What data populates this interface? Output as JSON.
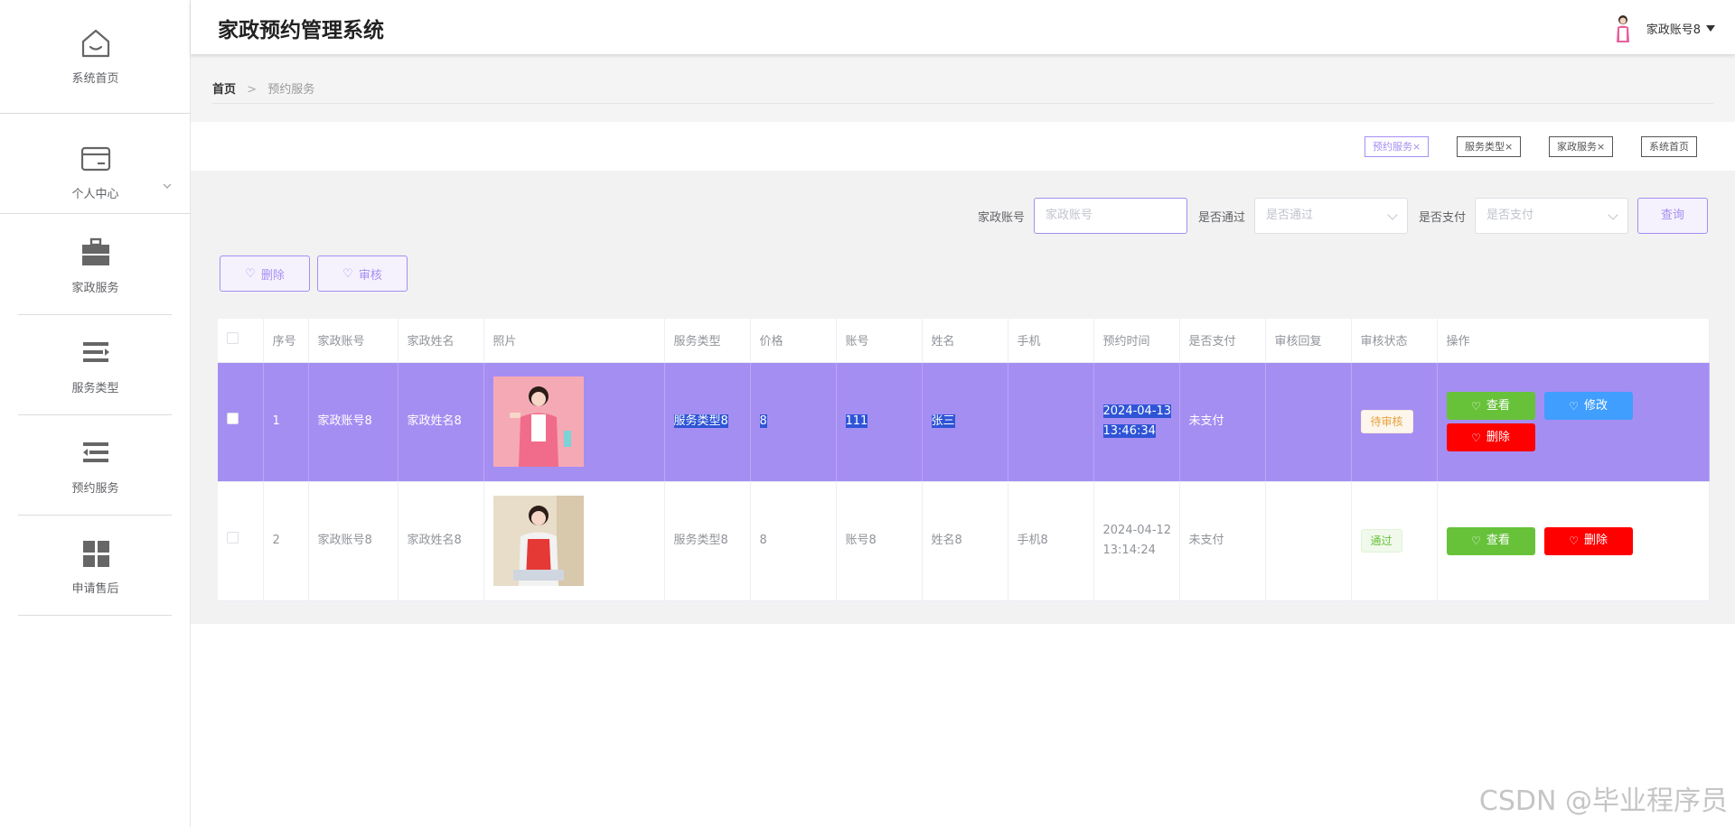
{
  "app": {
    "title": "家政预约管理系统"
  },
  "user": {
    "name": "家政账号8"
  },
  "sidebar": {
    "items": [
      {
        "label": "系统首页",
        "icon": "home-icon"
      },
      {
        "label": "个人中心",
        "icon": "card-icon"
      },
      {
        "label": "家政服务",
        "icon": "briefcase-icon"
      },
      {
        "label": "服务类型",
        "icon": "list-arrow-icon"
      },
      {
        "label": "预约服务",
        "icon": "list-left-icon"
      },
      {
        "label": "申请售后",
        "icon": "grid-icon"
      }
    ]
  },
  "breadcrumb": {
    "home": "首页",
    "separator": ">",
    "current": "预约服务"
  },
  "tabs": [
    {
      "label": "预约服务",
      "active": true
    },
    {
      "label": "服务类型"
    },
    {
      "label": "家政服务"
    },
    {
      "label": "系统首页"
    }
  ],
  "search": {
    "account_label": "家政账号",
    "account_placeholder": "家政账号",
    "approved_label": "是否通过",
    "approved_placeholder": "是否通过",
    "paid_label": "是否支付",
    "paid_placeholder": "是否支付",
    "query_label": "查询"
  },
  "actions": {
    "delete_label": "删除",
    "review_label": "审核"
  },
  "table": {
    "columns": [
      "序号",
      "家政账号",
      "家政姓名",
      "照片",
      "服务类型",
      "价格",
      "账号",
      "姓名",
      "手机",
      "预约时间",
      "是否支付",
      "审核回复",
      "审核状态",
      "操作"
    ],
    "rows": [
      {
        "index": "1",
        "account": "家政账号8",
        "name": "家政姓名8",
        "photo": "photo",
        "service_type": "服务类型8",
        "price": "8",
        "user_account": "111",
        "user_name": "张三",
        "phone": "",
        "time": "2024-04-13 13:46:34",
        "paid": "未支付",
        "reply": "",
        "status": "待审核",
        "ops": [
          "查看",
          "修改",
          "删除"
        ]
      },
      {
        "index": "2",
        "account": "家政账号8",
        "name": "家政姓名8",
        "photo": "photo",
        "service_type": "服务类型8",
        "price": "8",
        "user_account": "账号8",
        "user_name": "姓名8",
        "phone": "手机8",
        "time": "2024-04-12 13:14:24",
        "paid": "未支付",
        "reply": "",
        "status": "通过",
        "ops": [
          "查看",
          "删除"
        ]
      }
    ]
  },
  "watermark": "CSDN @毕业程序员",
  "colors": {
    "accent": "#a58ef2",
    "view": "#67c23a",
    "edit": "#409eff",
    "delete": "#ff0000"
  }
}
